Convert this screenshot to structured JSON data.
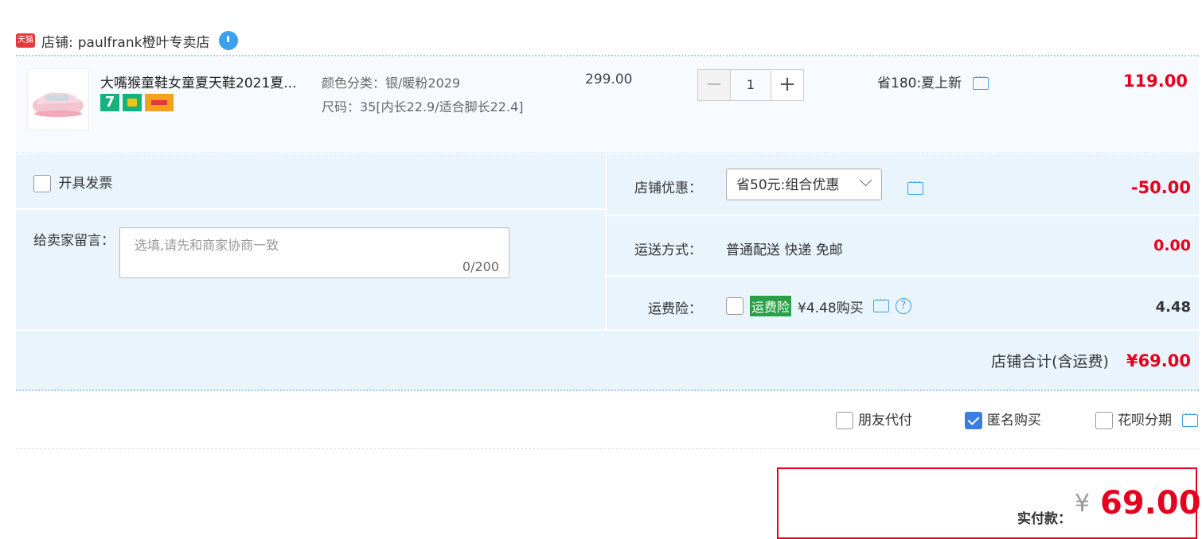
{
  "shop": {
    "tmall_label": "天猫",
    "prefix": "店铺:",
    "name": "paulfrank橙叶专卖店",
    "icon": "wangwang-chat-icon"
  },
  "item": {
    "title": "大嘴猴童鞋女童夏天鞋2021夏...",
    "badge_seven": "7",
    "sku_color": "颜色分类：银/暖粉2029",
    "sku_size": "尺码：35[内长22.9/适合脚长22.4]",
    "unit_price": "299.00",
    "quantity": "1",
    "qty_minus": "−",
    "qty_plus": "+",
    "discount": "省180:夏上新",
    "total": "119.00"
  },
  "options": {
    "invoice_label": "开具发票",
    "message_label": "给卖家留言：",
    "message_placeholder": "选填,请先和商家协商一致",
    "message_count": "0/200",
    "shop_promo_label": "店铺优惠：",
    "shop_promo_selected": "省50元:组合优惠",
    "shop_promo_value": "-50.00",
    "shipping_label": "运送方式：",
    "shipping_method": "普通配送 快递 免邮",
    "shipping_value": "0.00",
    "insurance_label": "运费险：",
    "insurance_tag": "运费险",
    "insurance_text": "¥4.48购买",
    "insurance_value": "4.48",
    "shop_total_label": "店铺合计(含运费)",
    "shop_total_value": "¥69.00"
  },
  "extras": {
    "friend_pay": "朋友代付",
    "anonymous": "匿名购买",
    "huabei": "花呗分期"
  },
  "payment": {
    "label": "实付款：",
    "currency": "¥",
    "amount": "69.00"
  },
  "colors": {
    "accent_red": "#e4001e",
    "accent_blue": "#3aa1ee",
    "panel_bg": "#eaf4fc"
  }
}
